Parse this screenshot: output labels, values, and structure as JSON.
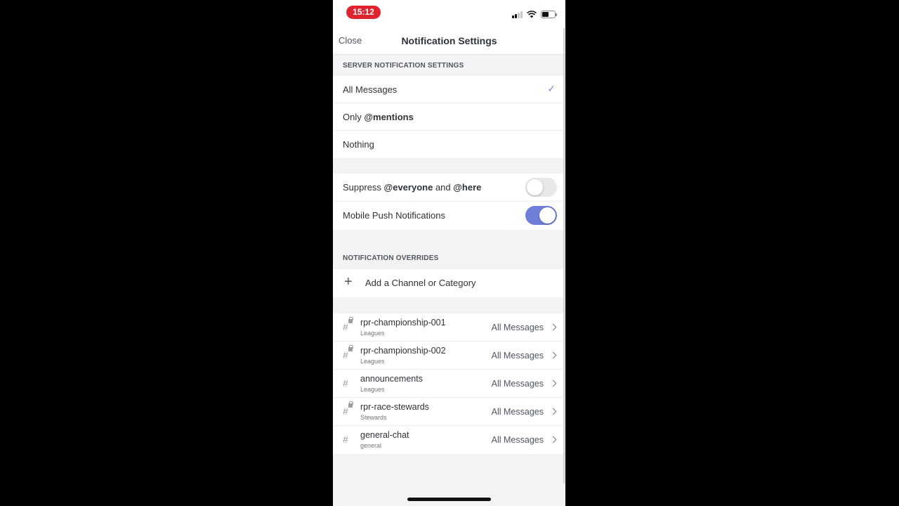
{
  "status_bar": {
    "time": "15:12"
  },
  "header": {
    "close_label": "Close",
    "title": "Notification Settings"
  },
  "server_settings": {
    "section_label": "SERVER NOTIFICATION SETTINGS",
    "options": [
      {
        "label": "All Messages",
        "selected": true
      },
      {
        "label_prefix": "Only ",
        "label_bold": "@mentions",
        "selected": false
      },
      {
        "label": "Nothing",
        "selected": false
      }
    ],
    "selected_mark": "✓"
  },
  "toggles": {
    "suppress": {
      "prefix": "Suppress ",
      "bold1": "@everyone",
      "middle": " and ",
      "bold2": "@here",
      "enabled": false
    },
    "mobile_push": {
      "label": "Mobile Push Notifications",
      "enabled": true
    }
  },
  "overrides": {
    "section_label": "NOTIFICATION OVERRIDES",
    "add_label": "Add a Channel or Category",
    "channels": [
      {
        "name": "rpr-championship-001",
        "category": "Leagues",
        "setting": "All Messages",
        "locked": true
      },
      {
        "name": "rpr-championship-002",
        "category": "Leagues",
        "setting": "All Messages",
        "locked": true
      },
      {
        "name": "announcements",
        "category": "Leagues",
        "setting": "All Messages",
        "locked": false
      },
      {
        "name": "rpr-race-stewards",
        "category": "Stewards",
        "setting": "All Messages",
        "locked": true
      },
      {
        "name": "general-chat",
        "category": "general",
        "setting": "All Messages",
        "locked": false
      }
    ]
  },
  "colors": {
    "accent": "#7289da",
    "toggle_on": "#6f7ed8",
    "time_pill": "#e0242f"
  },
  "icons": {
    "plus": "plus-icon",
    "hash": "hash-icon",
    "lock": "lock-icon",
    "chevron": "chevron-right-icon",
    "check": "checkmark-icon"
  }
}
